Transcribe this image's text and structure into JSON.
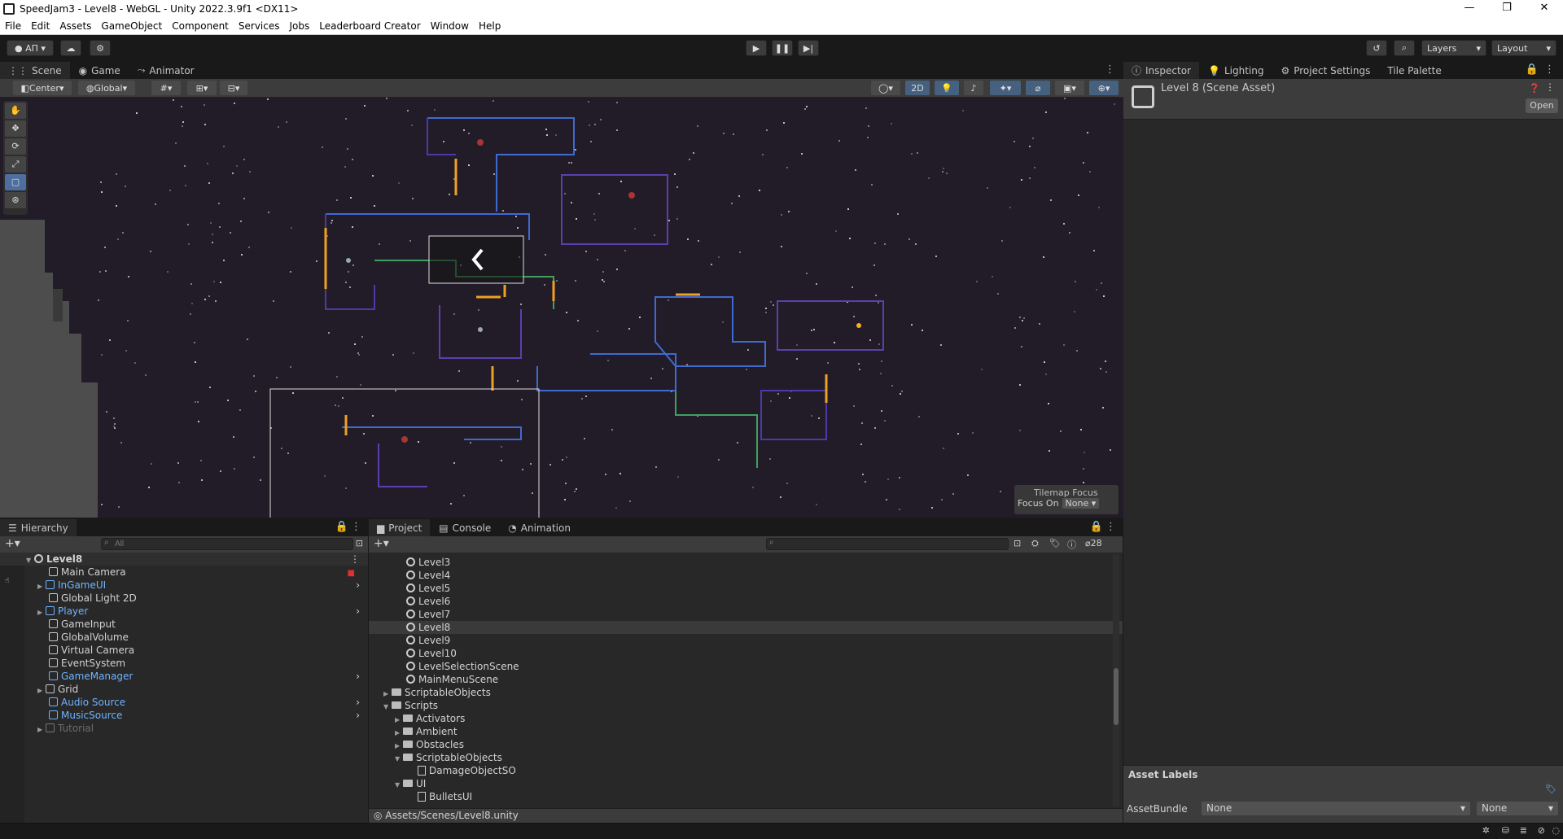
{
  "window": {
    "title": "SpeedJam3 - Level8 - WebGL - Unity 2022.3.9f1 <DX11>",
    "minimize": "—",
    "maximize": "❐",
    "close": "✕"
  },
  "menu": [
    "File",
    "Edit",
    "Assets",
    "GameObject",
    "Component",
    "Services",
    "Jobs",
    "Leaderboard Creator",
    "Window",
    "Help"
  ],
  "toolbar": {
    "account": "АП",
    "layers": "Layers",
    "layout": "Layout"
  },
  "scene": {
    "tabs": [
      "Scene",
      "Game",
      "Animator"
    ],
    "pivot": "Center",
    "space": "Global",
    "mode_2d": "2D",
    "tilemap_focus": {
      "title": "Tilemap Focus",
      "label": "Focus On",
      "value": "None"
    }
  },
  "inspector": {
    "tabs": [
      "Inspector",
      "Lighting",
      "Project Settings",
      "Tile Palette"
    ],
    "asset_title": "Level 8 (Scene Asset)",
    "open_label": "Open",
    "asset_labels": "Asset Labels",
    "assetbundle_label": "AssetBundle",
    "assetbundle_value": "None",
    "variant_value": "None"
  },
  "hierarchy": {
    "tab": "Hierarchy",
    "search_placeholder": "All",
    "root": "Level8",
    "items": [
      {
        "name": "Main Camera",
        "style": "normal",
        "expand": false
      },
      {
        "name": "InGameUI",
        "style": "prefab",
        "expand": true
      },
      {
        "name": "Global Light 2D",
        "style": "normal",
        "expand": false
      },
      {
        "name": "Player",
        "style": "prefab",
        "expand": true
      },
      {
        "name": "GameInput",
        "style": "normal",
        "expand": false
      },
      {
        "name": "GlobalVolume",
        "style": "normal",
        "expand": false
      },
      {
        "name": "Virtual Camera",
        "style": "normal",
        "expand": false
      },
      {
        "name": "EventSystem",
        "style": "normal",
        "expand": false
      },
      {
        "name": "GameManager",
        "style": "prefab",
        "expand": false
      },
      {
        "name": "Grid",
        "style": "normal",
        "expand": true
      },
      {
        "name": "Audio Source",
        "style": "prefab",
        "expand": false
      },
      {
        "name": "MusicSource",
        "style": "prefab",
        "expand": false
      },
      {
        "name": "Tutorial",
        "style": "disabled",
        "expand": true
      }
    ]
  },
  "project": {
    "tabs": [
      "Project",
      "Console",
      "Animation"
    ],
    "hidden_count": "28",
    "items": [
      {
        "name": "Level3",
        "type": "scene",
        "indent": 2
      },
      {
        "name": "Level4",
        "type": "scene",
        "indent": 2
      },
      {
        "name": "Level5",
        "type": "scene",
        "indent": 2
      },
      {
        "name": "Level6",
        "type": "scene",
        "indent": 2
      },
      {
        "name": "Level7",
        "type": "scene",
        "indent": 2
      },
      {
        "name": "Level8",
        "type": "scene",
        "indent": 2,
        "selected": true
      },
      {
        "name": "Level9",
        "type": "scene",
        "indent": 2
      },
      {
        "name": "Level10",
        "type": "scene",
        "indent": 2
      },
      {
        "name": "LevelSelectionScene",
        "type": "scene",
        "indent": 2
      },
      {
        "name": "MainMenuScene",
        "type": "scene",
        "indent": 2
      },
      {
        "name": "ScriptableObjects",
        "type": "folder",
        "indent": 1,
        "arrow": "▶"
      },
      {
        "name": "Scripts",
        "type": "folder",
        "indent": 1,
        "arrow": "▼"
      },
      {
        "name": "Activators",
        "type": "folder",
        "indent": 2,
        "arrow": "▶"
      },
      {
        "name": "Ambient",
        "type": "folder",
        "indent": 2,
        "arrow": "▶"
      },
      {
        "name": "Obstacles",
        "type": "folder",
        "indent": 2,
        "arrow": "▶"
      },
      {
        "name": "ScriptableObjects",
        "type": "folder",
        "indent": 2,
        "arrow": "▼"
      },
      {
        "name": "DamageObjectSO",
        "type": "script",
        "indent": 3
      },
      {
        "name": "UI",
        "type": "folder",
        "indent": 2,
        "arrow": "▼"
      },
      {
        "name": "BulletsUI",
        "type": "script",
        "indent": 3
      }
    ],
    "path": "Assets/Scenes/Level8.unity"
  }
}
